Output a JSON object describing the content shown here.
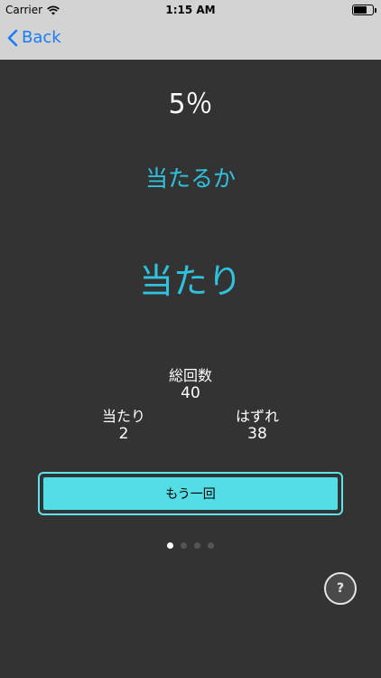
{
  "status_bar": {
    "carrier": "Carrier",
    "time": "1:15 AM",
    "battery_level": 0.7
  },
  "nav": {
    "back_label": "Back",
    "accent_color": "#1a7cf5"
  },
  "main": {
    "percent": "5％",
    "question": "当たるか",
    "result": "当たり",
    "total_label": "総回数",
    "total_value": "40",
    "hit_label": "当たり",
    "hit_value": "2",
    "miss_label": "はずれ",
    "miss_value": "38",
    "retry_label": "もう一回",
    "accent_color": "#2fc2dd"
  },
  "pager": {
    "page_count": 4,
    "current_page": 1
  },
  "help": {
    "label": "?"
  },
  "icons": [
    "wifi-icon",
    "battery-icon",
    "chevron-left-icon"
  ]
}
